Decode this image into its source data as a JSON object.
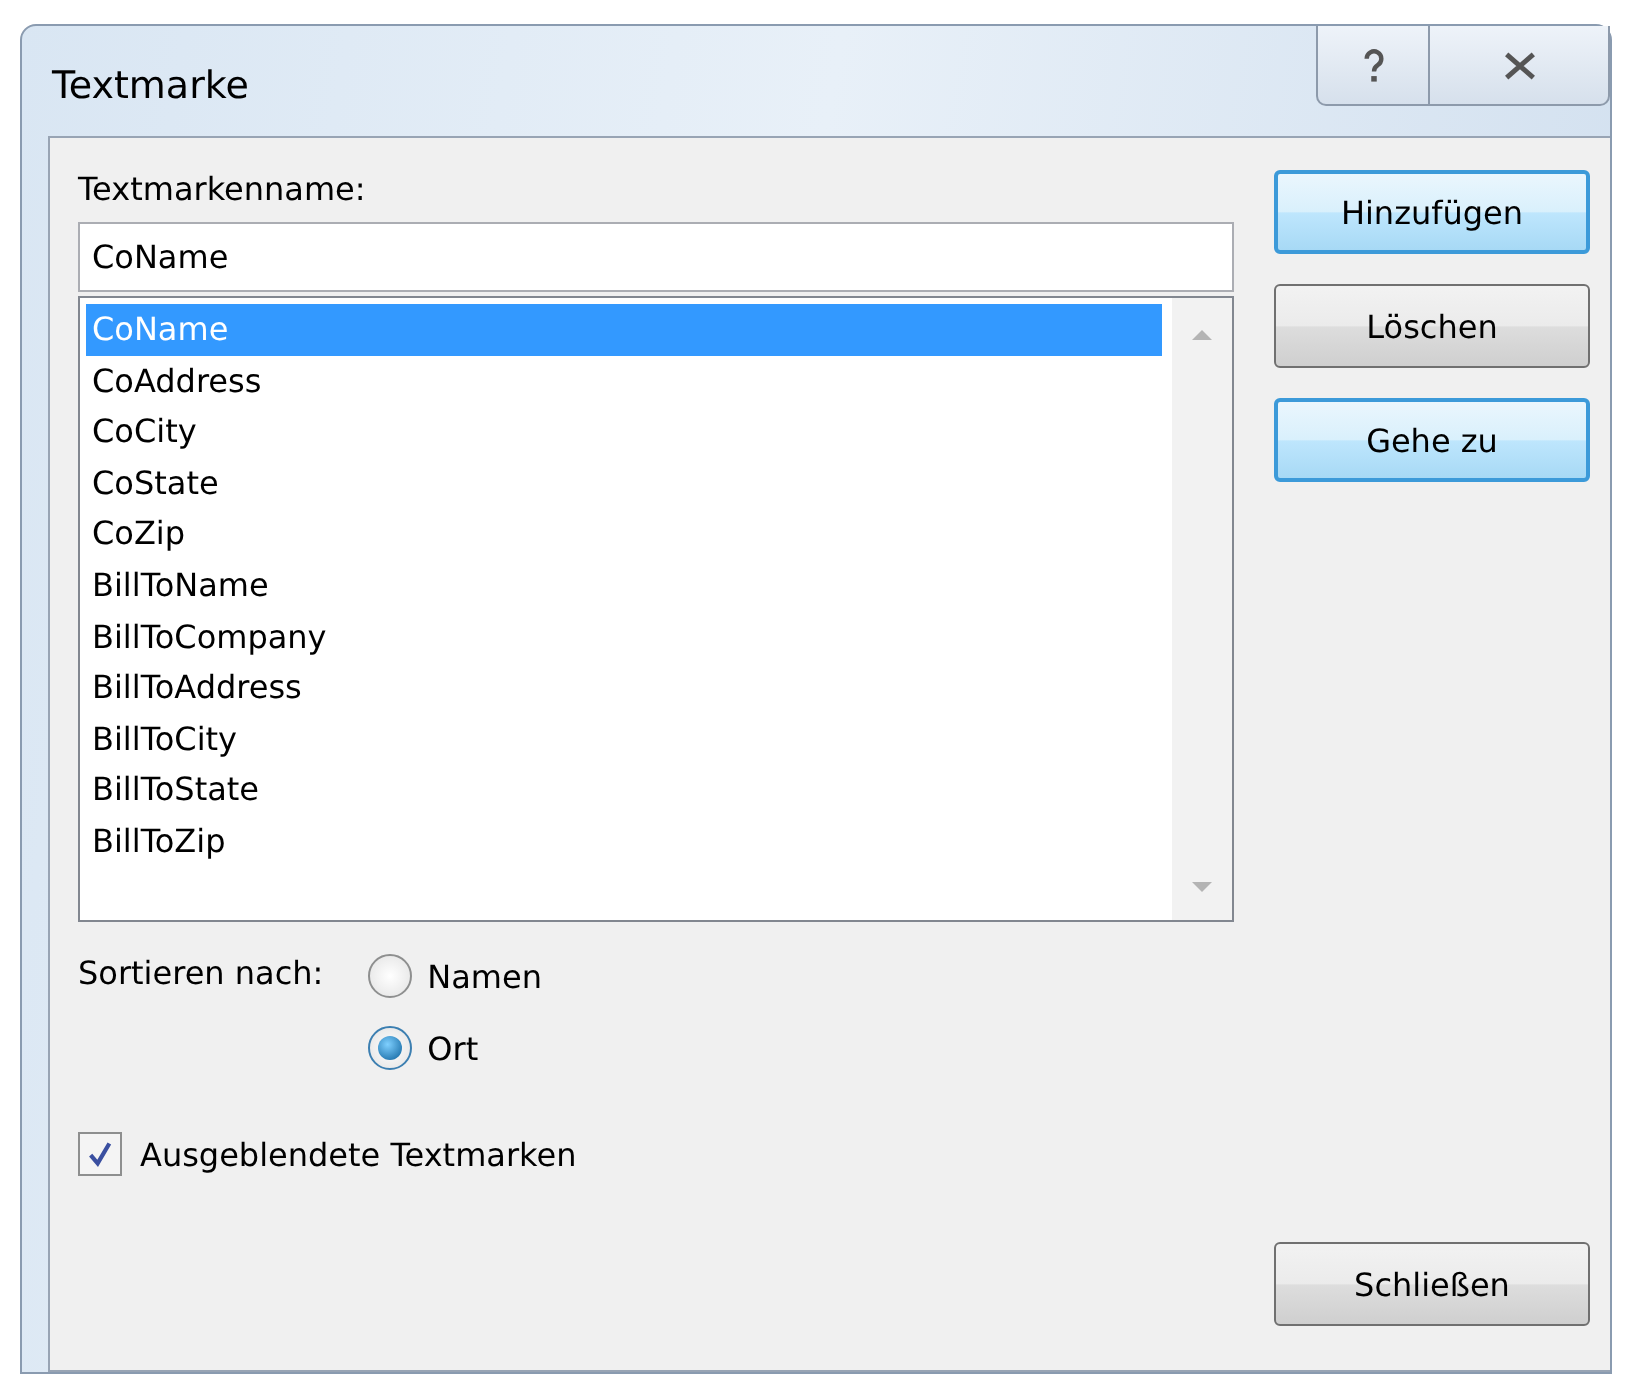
{
  "window": {
    "title": "Textmarke",
    "title_buttons": [
      {
        "kind": "help"
      },
      {
        "kind": "close"
      }
    ]
  },
  "name_label": "Textmarkenname:",
  "name_field": {
    "value": "CoName"
  },
  "bookmarks": [
    {
      "label": "CoName",
      "selected": true
    },
    {
      "label": "CoAddress",
      "selected": false
    },
    {
      "label": "CoCity",
      "selected": false
    },
    {
      "label": "CoState",
      "selected": false
    },
    {
      "label": "CoZip",
      "selected": false
    },
    {
      "label": "BillToName",
      "selected": false
    },
    {
      "label": "BillToCompany",
      "selected": false
    },
    {
      "label": "BillToAddress",
      "selected": false
    },
    {
      "label": "BillToCity",
      "selected": false
    },
    {
      "label": "BillToState",
      "selected": false
    },
    {
      "label": "BillToZip",
      "selected": false
    }
  ],
  "side_buttons": [
    {
      "label": "Hinzufügen",
      "focused": true
    },
    {
      "label": "Löschen",
      "focused": false
    },
    {
      "label": "Gehe zu",
      "focused": true
    }
  ],
  "sort": {
    "label": "Sortieren nach:",
    "options": [
      {
        "label": "Namen",
        "selected": false
      },
      {
        "label": "Ort",
        "selected": true
      }
    ]
  },
  "hidden_bookmarks": {
    "label": "Ausgeblendete Textmarken",
    "checked": true
  },
  "close_button": {
    "label": "Schließen"
  }
}
